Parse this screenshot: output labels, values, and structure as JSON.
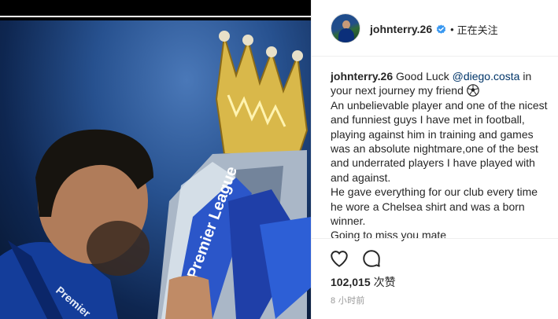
{
  "post": {
    "username": "johnterry.26",
    "verified": true,
    "follow_status": "正在关注",
    "separator": "•"
  },
  "caption": {
    "user": "johnterry.26",
    "line1_pre": "Good Luck ",
    "mention": "@diego.costa",
    "line1_post": " in your next journey my friend ",
    "emoji_icon": "soccer-ball-icon",
    "paragraph1": "An unbelievable player and one of the nicest and funniest guys I have met in football, playing against him in training and games was an absolute nightmare,one of the best and underrated players I have played with and against.",
    "paragraph2": "He gave everything for our club every time he wore a Chelsea shirt and was a born winner.",
    "paragraph3": "Going to miss you mate"
  },
  "photo": {
    "jersey_text": "Premier",
    "trophy_ribbon_text": "Premier League"
  },
  "actions": {
    "like_icon": "heart-icon",
    "comment_icon": "comment-icon",
    "likes_count": "102,015",
    "likes_unit": "次赞",
    "time_ago": "8 小时前"
  },
  "colors": {
    "mention": "#003569",
    "verified": "#3897f0",
    "muted": "#999999",
    "text": "#262626"
  }
}
